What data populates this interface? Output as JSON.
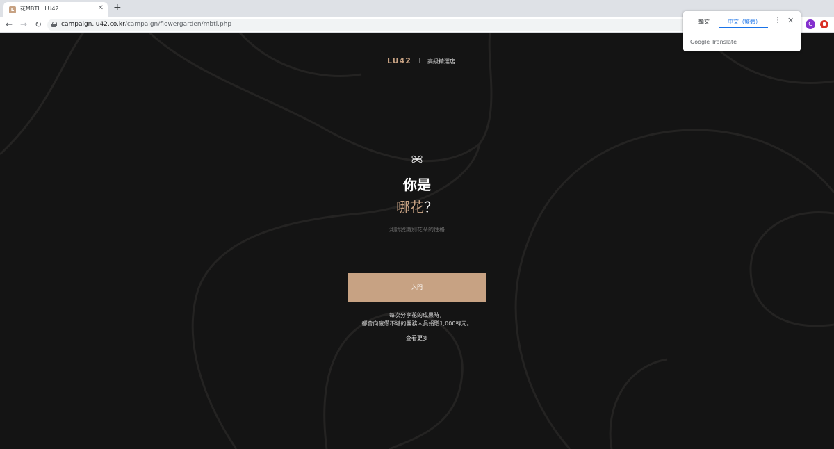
{
  "browser": {
    "tab_title": "花MBTI | LU42",
    "tab_favicon_letter": "L",
    "url_host": "campaign.lu42.co.kr",
    "url_path": "/campaign/flowergarden/mbti.php",
    "avatar_letter": "C"
  },
  "translate_popup": {
    "source_lang": "韓文",
    "target_lang": "中文（繁體）",
    "brand": "Google Translate"
  },
  "header": {
    "logo": "LU42",
    "tagline": "高級精選店"
  },
  "hero": {
    "title_line1": "你是",
    "title_accent": "哪花",
    "title_suffix": "？",
    "subtitle": "測試我識別花朵的性格"
  },
  "cta": {
    "start_label": "入門",
    "note_line1": "每次分享花的成果時，",
    "note_line2": "都會向疲憊不堪的醫務人員捐贈1,000韓元。",
    "more_label": "查看更多"
  },
  "colors": {
    "accent": "#c7a283",
    "background": "#141414"
  }
}
